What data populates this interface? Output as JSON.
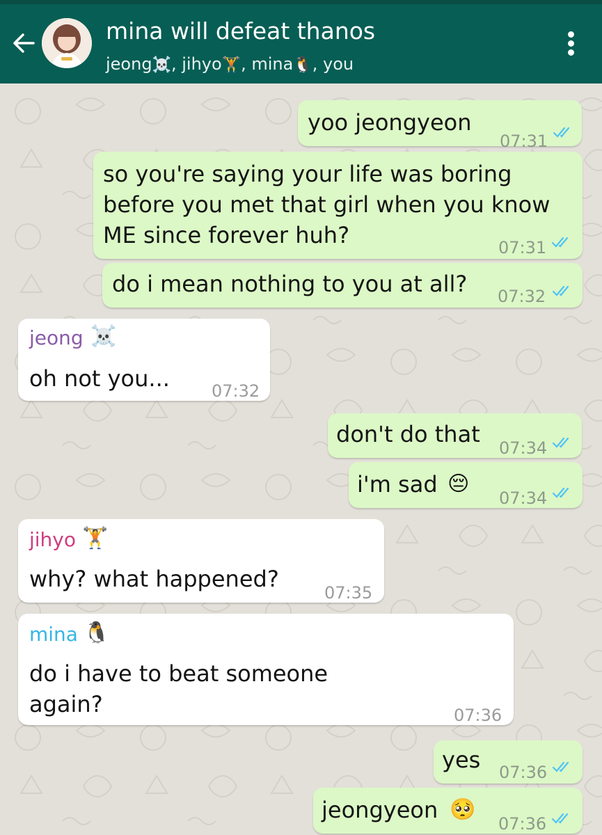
{
  "header": {
    "group_name": "mina will defeat thanos",
    "members": [
      {
        "name": "jeong",
        "emoji": "☠️"
      },
      {
        "name": "jihyo",
        "emoji": "🏋️"
      },
      {
        "name": "mina",
        "emoji": "🐧"
      },
      {
        "name": "you",
        "emoji": ""
      }
    ],
    "sep": ", "
  },
  "colors": {
    "header_bg": "#075e54",
    "outgoing_bubble": "#dcf8c6",
    "incoming_bubble": "#ffffff",
    "read_ticks": "#4fc3f7",
    "sender_jeong": "#8a5ba8",
    "sender_jihyo": "#d03d7f",
    "sender_mina": "#35b6e3"
  },
  "messages": [
    {
      "direction": "out",
      "text": "yoo jeongyeon",
      "time": "07:31",
      "status": "read"
    },
    {
      "direction": "out",
      "text": "so you're saying your life was boring\nbefore you met that girl when you know\nME since forever huh?",
      "time": "07:31",
      "status": "read"
    },
    {
      "direction": "out",
      "text": "do i mean nothing to you at all?",
      "time": "07:32",
      "status": "read"
    },
    {
      "direction": "in",
      "sender": "jeong",
      "sender_emoji": "☠️",
      "text": "oh not you...",
      "time": "07:32"
    },
    {
      "direction": "out",
      "text": "don't do that",
      "time": "07:34",
      "status": "read"
    },
    {
      "direction": "out",
      "text": "i'm sad",
      "emoji": "😔",
      "time": "07:34",
      "status": "read"
    },
    {
      "direction": "in",
      "sender": "jihyo",
      "sender_emoji": "🏋️",
      "text": "why? what happened?",
      "time": "07:35"
    },
    {
      "direction": "in",
      "sender": "mina",
      "sender_emoji": "🐧",
      "text": "do i have to beat someone\nagain?",
      "time": "07:36"
    },
    {
      "direction": "out",
      "text": "yes",
      "time": "07:36",
      "status": "read"
    },
    {
      "direction": "out",
      "text": "jeongyeon",
      "emoji": "🥺",
      "time": "07:36",
      "status": "read"
    }
  ]
}
